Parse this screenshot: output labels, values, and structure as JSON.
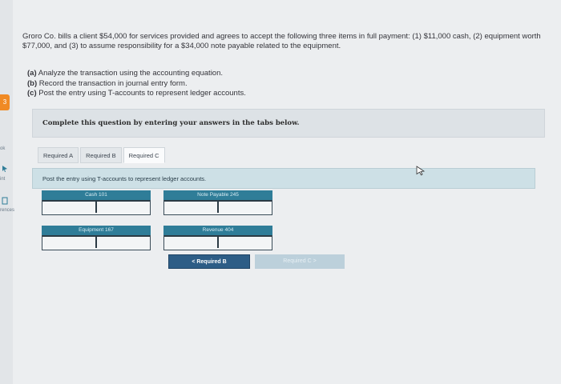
{
  "sidebar": {
    "badge": "3",
    "labels": [
      "ok",
      "int",
      "rences"
    ]
  },
  "question": {
    "text": "Groro Co. bills a client $54,000 for services provided and agrees to accept the following three items in full payment: (1) $11,000 cash, (2) equipment worth $77,000, and (3) to assume responsibility for a $34,000 note payable related to the equipment.",
    "tasks": [
      {
        "letter": "(a)",
        "text": "Analyze the transaction using the accounting equation."
      },
      {
        "letter": "(b)",
        "text": "Record the transaction in journal entry form."
      },
      {
        "letter": "(c)",
        "text": "Post the entry using T-accounts to represent ledger accounts."
      }
    ]
  },
  "instruction": "Complete this question by entering your answers in the tabs below.",
  "tabs": [
    "Required A",
    "Required B",
    "Required C"
  ],
  "panel": {
    "header": "Post the entry using T-accounts to represent ledger accounts."
  },
  "accounts": [
    {
      "name": "Cash 101"
    },
    {
      "name": "Note Payable 245"
    },
    {
      "name": "Equipment 167"
    },
    {
      "name": "Revenue 404"
    }
  ],
  "nav": {
    "prev": "< Required B",
    "next": "Required C >"
  },
  "colors": {
    "accent": "#2f7d98",
    "button": "#2d5d86",
    "badge": "#f08a24"
  }
}
